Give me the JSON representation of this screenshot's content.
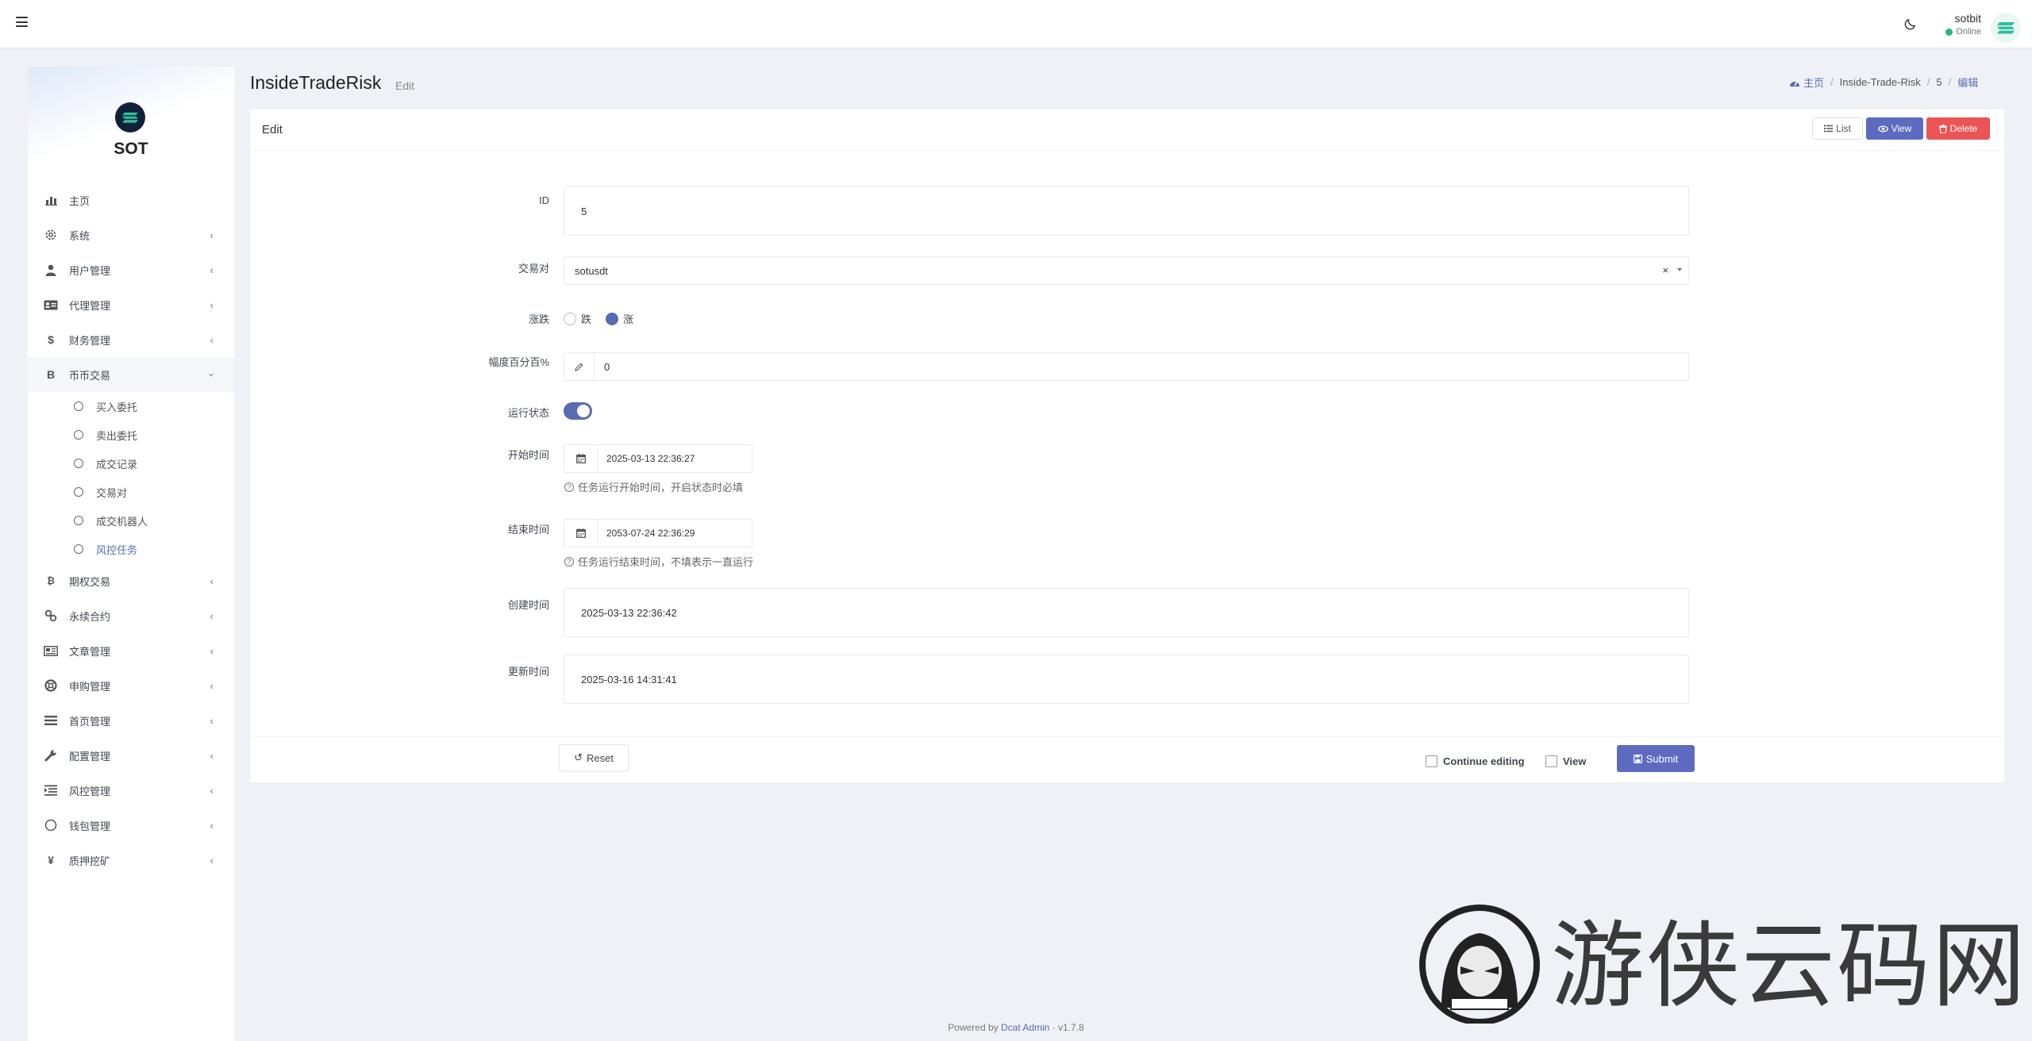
{
  "navbar": {
    "user_name": "sotbit",
    "user_status": "Online"
  },
  "sidebar": {
    "brand": "SOT",
    "items": [
      {
        "label": "主页",
        "icon": "bar-chart-icon",
        "has_children": false
      },
      {
        "label": "系统",
        "icon": "gear-icon",
        "has_children": true
      },
      {
        "label": "用户管理",
        "icon": "user-tie-icon",
        "has_children": true
      },
      {
        "label": "代理管理",
        "icon": "id-card-icon",
        "has_children": true
      },
      {
        "label": "财务管理",
        "icon": "dollar-icon",
        "has_children": true
      },
      {
        "label": "币币交易",
        "icon": "bitcoin-icon",
        "has_children": true,
        "expanded": true
      }
    ],
    "subitems": [
      {
        "label": "买入委托"
      },
      {
        "label": "卖出委托"
      },
      {
        "label": "成交记录"
      },
      {
        "label": "交易对"
      },
      {
        "label": "成交机器人"
      },
      {
        "label": "风控任务",
        "current": true
      }
    ],
    "items_after": [
      {
        "label": "期权交易",
        "icon": "bitcoin-icon"
      },
      {
        "label": "永续合约",
        "icon": "link-icon"
      },
      {
        "label": "文章管理",
        "icon": "newspaper-icon"
      },
      {
        "label": "申购管理",
        "icon": "lifebuoy-icon"
      },
      {
        "label": "首页管理",
        "icon": "list-icon"
      },
      {
        "label": "配置管理",
        "icon": "wrench-icon"
      },
      {
        "label": "风控管理",
        "icon": "indent-icon"
      },
      {
        "label": "钱包管理",
        "icon": "circle-icon"
      },
      {
        "label": "质押挖矿",
        "icon": "yen-icon"
      }
    ]
  },
  "header": {
    "title": "InsideTradeRisk",
    "subtitle": "Edit",
    "breadcrumb": [
      "主页",
      "Inside-Trade-Risk",
      "5",
      "编辑"
    ]
  },
  "card": {
    "title": "Edit",
    "list_label": "List",
    "view_label": "View",
    "delete_label": "Delete"
  },
  "form": {
    "id": {
      "label": "ID",
      "value": "5"
    },
    "pair": {
      "label": "交易对",
      "value": "sotusdt"
    },
    "direction": {
      "label": "涨跌",
      "options": [
        "跌",
        "涨"
      ],
      "selected": "涨"
    },
    "percent": {
      "label": "幅度百分百%",
      "value": "0"
    },
    "running": {
      "label": "运行状态",
      "on": true
    },
    "start_time": {
      "label": "开始时间",
      "value": "2025-03-13 22:36:27",
      "help": "任务运行开始时间，开启状态时必填"
    },
    "end_time": {
      "label": "结束时间",
      "value": "2053-07-24 22:36:29",
      "help": "任务运行结束时间，不填表示一直运行"
    },
    "created_at": {
      "label": "创建时间",
      "value": "2025-03-13 22:36:42"
    },
    "updated_at": {
      "label": "更新时间",
      "value": "2025-03-16 14:31:41"
    }
  },
  "footer_actions": {
    "reset_label": "Reset",
    "continue_editing_label": "Continue editing",
    "view_label": "View",
    "submit_label": "Submit"
  },
  "footer": {
    "powered_by": "Powered by",
    "link": "Dcat Admin",
    "sep": "·",
    "version": "v1.7.8"
  },
  "watermark": {
    "text": "游侠云码网"
  },
  "colors": {
    "primary": "#586cb1",
    "button_primary": "#5c6bc0",
    "danger": "#ea5455",
    "online": "#21b978",
    "background": "#eff1f6"
  }
}
